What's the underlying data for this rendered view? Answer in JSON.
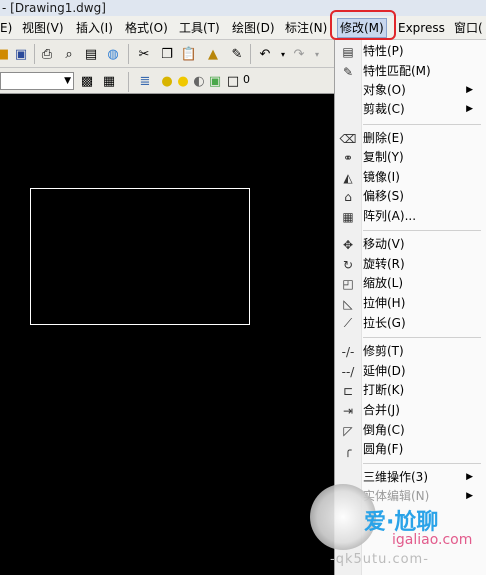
{
  "window": {
    "title": "- [Drawing1.dwg]"
  },
  "menubar": {
    "items": [
      {
        "label": "E)"
      },
      {
        "label": "视图(V)"
      },
      {
        "label": "插入(I)"
      },
      {
        "label": "格式(O)"
      },
      {
        "label": "工具(T)"
      },
      {
        "label": "绘图(D)"
      },
      {
        "label": "标注(N)"
      },
      {
        "label": "修改(M)"
      },
      {
        "label": "Express"
      },
      {
        "label": "窗口("
      }
    ],
    "highlight_color": "#e0262b"
  },
  "toolbar": {
    "icons": [
      "save-icon",
      "print-icon",
      "plot-preview-icon",
      "publish-icon",
      "globe-icon",
      "cut-icon",
      "copy-icon",
      "paste-icon",
      "paintbrush-icon",
      "match-properties-icon",
      "undo-icon",
      "redo-icon"
    ],
    "layer_state": "0"
  },
  "modify_menu": {
    "items": [
      {
        "label": "特性(P)",
        "icon": "properties-icon"
      },
      {
        "label": "特性匹配(M)",
        "icon": "match-brush-icon"
      },
      {
        "label": "对象(O)",
        "icon": "",
        "submenu": true
      },
      {
        "label": "剪裁(C)",
        "icon": "",
        "submenu": true
      },
      {
        "label": "删除(E)",
        "icon": "eraser-icon"
      },
      {
        "label": "复制(Y)",
        "icon": "copy-object-icon"
      },
      {
        "label": "镜像(I)",
        "icon": "mirror-icon"
      },
      {
        "label": "偏移(S)",
        "icon": "offset-icon"
      },
      {
        "label": "阵列(A)...",
        "icon": "array-icon"
      },
      {
        "label": "移动(V)",
        "icon": "move-icon"
      },
      {
        "label": "旋转(R)",
        "icon": "rotate-icon"
      },
      {
        "label": "缩放(L)",
        "icon": "scale-icon"
      },
      {
        "label": "拉伸(H)",
        "icon": "stretch-icon"
      },
      {
        "label": "拉长(G)",
        "icon": "lengthen-icon"
      },
      {
        "label": "修剪(T)",
        "icon": "trim-icon"
      },
      {
        "label": "延伸(D)",
        "icon": "extend-icon"
      },
      {
        "label": "打断(K)",
        "icon": "break-icon"
      },
      {
        "label": "合并(J)",
        "icon": "join-icon"
      },
      {
        "label": "倒角(C)",
        "icon": "chamfer-icon"
      },
      {
        "label": "圆角(F)",
        "icon": "fillet-icon"
      },
      {
        "label": "三维操作(3)",
        "icon": "",
        "submenu": true
      },
      {
        "label": "实体编辑(N)",
        "icon": "",
        "submenu": true
      }
    ]
  },
  "watermark": {
    "brand": "爱·尬聊",
    "site": "igaliao.com",
    "sub": "-qk5utu.com-"
  }
}
